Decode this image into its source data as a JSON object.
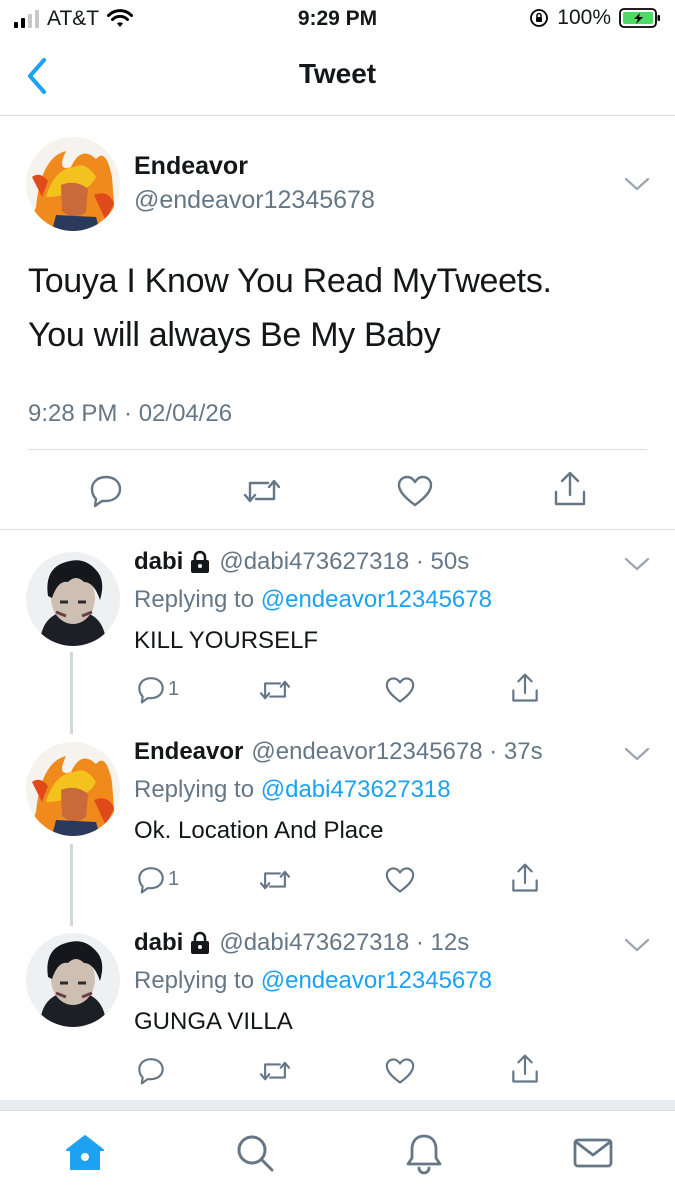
{
  "status_bar": {
    "carrier": "AT&T",
    "time": "9:29 PM",
    "battery": "100%"
  },
  "nav": {
    "title": "Tweet"
  },
  "main_tweet": {
    "name": "Endeavor",
    "handle": "@endeavor12345678",
    "text_line1": "Touya I Know You Read MyTweets.",
    "text_line2": "You will always Be My Baby",
    "timestamp": "9:28 PM · 02/04/26"
  },
  "replies": [
    {
      "name": "dabi",
      "locked": true,
      "meta": "@dabi473627318 · 50s",
      "replying_prefix": "Replying to ",
      "replying_to": "@endeavor12345678",
      "text": "KILL YOURSELF",
      "reply_count": "1"
    },
    {
      "name": "Endeavor",
      "locked": false,
      "meta": "@endeavor12345678 · 37s",
      "replying_prefix": "Replying to ",
      "replying_to": "@dabi473627318",
      "text": "Ok. Location And Place",
      "reply_count": "1"
    },
    {
      "name": "dabi",
      "locked": true,
      "meta": "@dabi473627318 · 12s",
      "replying_prefix": "Replying to ",
      "replying_to": "@endeavor12345678",
      "text": "GUNGA VILLA",
      "reply_count": ""
    }
  ],
  "icons": {
    "reply": "reply-icon",
    "retweet": "retweet-icon",
    "like": "heart-icon",
    "share": "share-icon",
    "home": "home-icon",
    "search": "search-icon",
    "notifications": "bell-icon",
    "messages": "mail-icon"
  },
  "colors": {
    "accent": "#1da1f2",
    "secondary_text": "#657786",
    "battery_green": "#4cd964"
  }
}
